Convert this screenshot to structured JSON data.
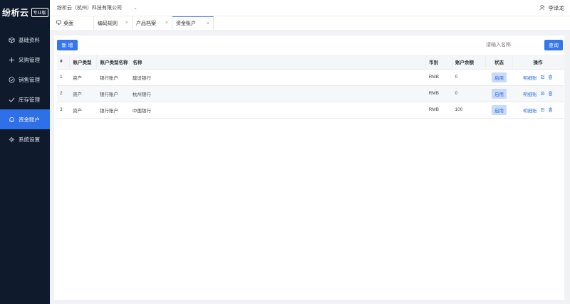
{
  "app": {
    "logo_text": "纷析云",
    "edition_badge": "专业版"
  },
  "sidebar": {
    "items": [
      {
        "label": "基础资料",
        "icon": "box-icon",
        "active": false
      },
      {
        "label": "采购管理",
        "icon": "plus-icon",
        "active": false
      },
      {
        "label": "销售管理",
        "icon": "check-circle-icon",
        "active": false
      },
      {
        "label": "库存管理",
        "icon": "check-icon",
        "active": false
      },
      {
        "label": "资金账户",
        "icon": "bell-icon",
        "active": true
      },
      {
        "label": "系统设置",
        "icon": "gear-icon",
        "active": false
      }
    ]
  },
  "header": {
    "company": "纷析云（杭州）科技有限公司",
    "user": "李泽龙"
  },
  "tabs": [
    {
      "label": "桌面",
      "closable": false
    },
    {
      "label": "编码规则",
      "closable": true
    },
    {
      "label": "产品档案",
      "closable": true
    },
    {
      "label": "资金账户",
      "closable": true,
      "active": true
    }
  ],
  "toolbar": {
    "add_label": "新 增",
    "search_placeholder": "请输入名称",
    "query_label": "查询"
  },
  "table": {
    "headers": [
      "#",
      "账户类型",
      "账户类型名称",
      "名称",
      "币别",
      "账户余额",
      "状态",
      "操作"
    ],
    "rows": [
      {
        "index": "1",
        "type": "资产",
        "type_name": "银行账户",
        "name": "建设银行",
        "currency": "RMB",
        "balance": "0",
        "status": "启用",
        "op": "明细账"
      },
      {
        "index": "2",
        "type": "资产",
        "type_name": "银行账户",
        "name": "杭州银行",
        "currency": "RMB",
        "balance": "0",
        "status": "启用",
        "op": "明细账"
      },
      {
        "index": "3",
        "type": "资产",
        "type_name": "银行账户",
        "name": "中国银行",
        "currency": "RMB",
        "balance": "100",
        "status": "启用",
        "op": "明细账"
      }
    ]
  },
  "colors": {
    "sidebar_bg": "#0f1b2d",
    "accent": "#3575f0",
    "badge_bg": "#c9daf8"
  }
}
